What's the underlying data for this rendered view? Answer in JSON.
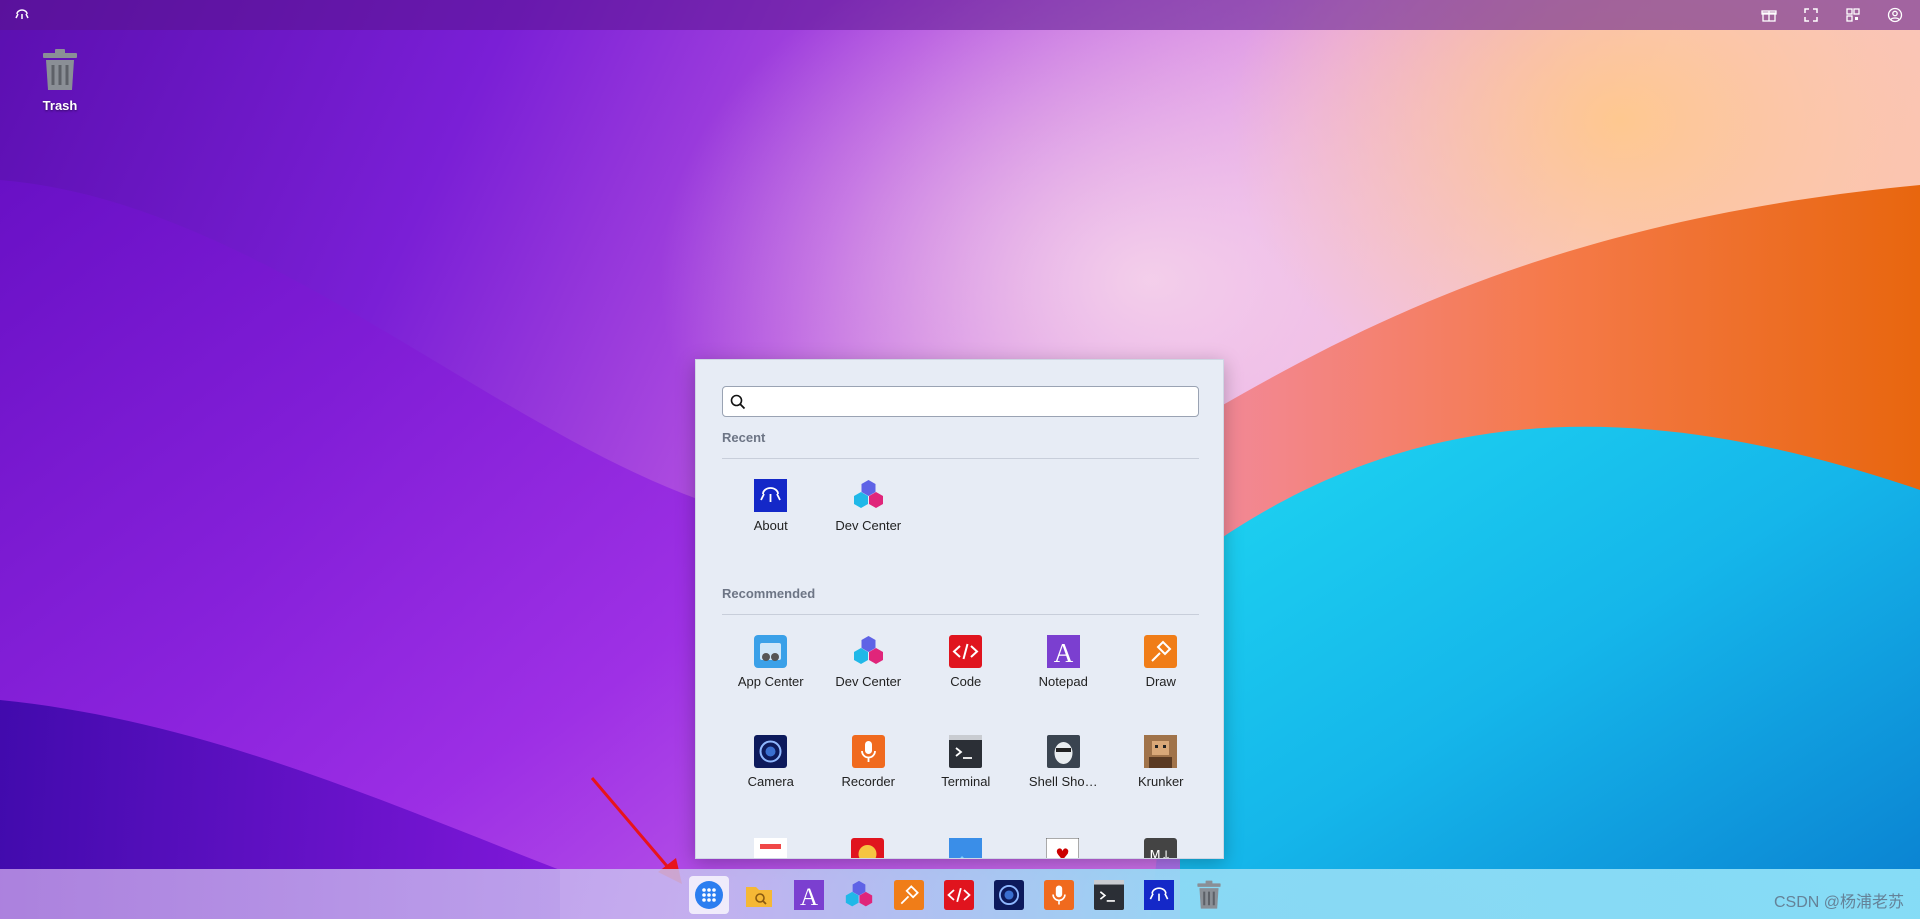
{
  "desktop": {
    "icons": [
      {
        "label": "Trash",
        "icon": "trash-icon"
      }
    ]
  },
  "topbar": {
    "logo_icon": "cloud-logo-icon",
    "right_icons": [
      "gift-icon",
      "fullscreen-icon",
      "qr-code-icon",
      "user-icon"
    ]
  },
  "start_menu": {
    "search": {
      "value": "",
      "placeholder": ""
    },
    "recent_title": "Recent",
    "recent": [
      {
        "label": "About",
        "icon": "about-icon"
      },
      {
        "label": "Dev Center",
        "icon": "dev-center-icon"
      }
    ],
    "recommended_title": "Recommended",
    "recommended": [
      {
        "label": "App Center",
        "icon": "app-center-icon"
      },
      {
        "label": "Dev Center",
        "icon": "dev-center-icon"
      },
      {
        "label": "Code",
        "icon": "code-icon"
      },
      {
        "label": "Notepad",
        "icon": "notepad-icon"
      },
      {
        "label": "Draw",
        "icon": "draw-icon"
      },
      {
        "label": "Camera",
        "icon": "camera-icon"
      },
      {
        "label": "Recorder",
        "icon": "recorder-icon"
      },
      {
        "label": "Terminal",
        "icon": "terminal-icon"
      },
      {
        "label": "Shell Sho…",
        "icon": "shell-shockers-icon"
      },
      {
        "label": "Krunker",
        "icon": "krunker-icon"
      }
    ]
  },
  "taskbar": {
    "items": [
      "start-menu-icon",
      "file-explorer-icon",
      "notepad-icon",
      "dev-center-icon",
      "draw-icon",
      "code-icon",
      "camera-icon",
      "recorder-icon",
      "terminal-icon",
      "about-icon",
      "trash-icon"
    ],
    "watermark": "CSDN @杨浦老苏"
  },
  "colors": {
    "about_blue": "#1428c8",
    "code_red": "#e0141e",
    "notepad_purple": "#7b3fd0",
    "draw_orange": "#f07d18",
    "camera_navy": "#0d1a5c",
    "recorder_orange": "#f06a1e",
    "terminal_dark": "#2b2f36"
  }
}
